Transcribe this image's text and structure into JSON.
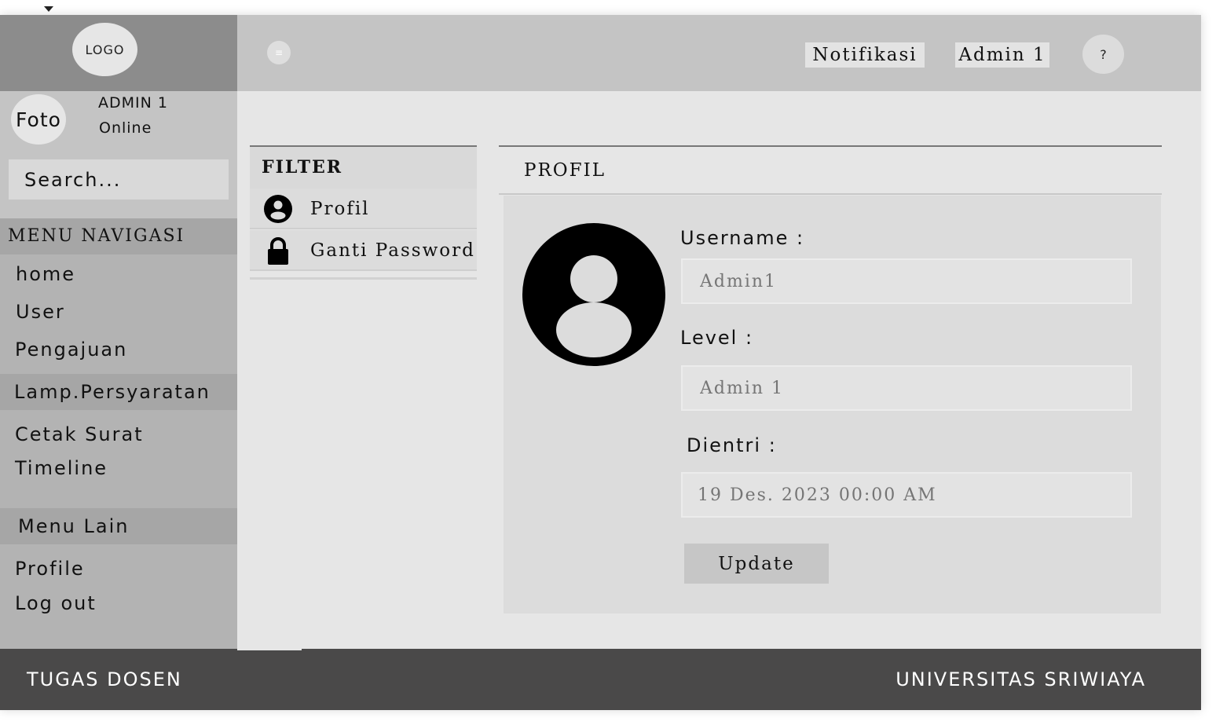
{
  "sidebar": {
    "logo": "LOGO",
    "user": {
      "photo": "Foto",
      "name": "ADMIN 1",
      "status": "Online"
    },
    "search_placeholder": "Search...",
    "nav_heading": "MENU NAVIGASI",
    "nav_items": [
      "home",
      "User",
      "Pengajuan",
      "Lamp.Persyaratan",
      "Cetak Surat",
      "Timeline"
    ],
    "other_heading": "Menu Lain",
    "other_items": [
      "Profile",
      "Log out"
    ]
  },
  "topbar": {
    "menu_icon": "hamburger-icon",
    "notifications_label": "Notifikasi",
    "user_label": "Admin 1",
    "help_label": "?"
  },
  "filter": {
    "heading": "FILTER",
    "items": [
      {
        "label": "Profil",
        "icon": "user-circle-icon"
      },
      {
        "label": "Ganti Password",
        "icon": "lock-icon"
      }
    ]
  },
  "profile": {
    "heading": "PROFIL",
    "avatar_icon": "user-avatar-icon",
    "username_label": "Username :",
    "username_placeholder": "Admin1",
    "level_label": "Level :",
    "level_placeholder": "Admin 1",
    "entry_label": "Dientri :",
    "entry_placeholder": "19 Des. 2023 00:00 AM",
    "update_label": "Update"
  },
  "footer": {
    "left": "TUGAS DOSEN",
    "right": "UNIVERSITAS SRIWIAYA"
  },
  "colors": {
    "sidebar": "#b3b3b3",
    "logo_bar": "#8c8c8c",
    "topbar": "#c4c4c4",
    "content": "#e6e6e6",
    "footer": "#4a4949"
  }
}
